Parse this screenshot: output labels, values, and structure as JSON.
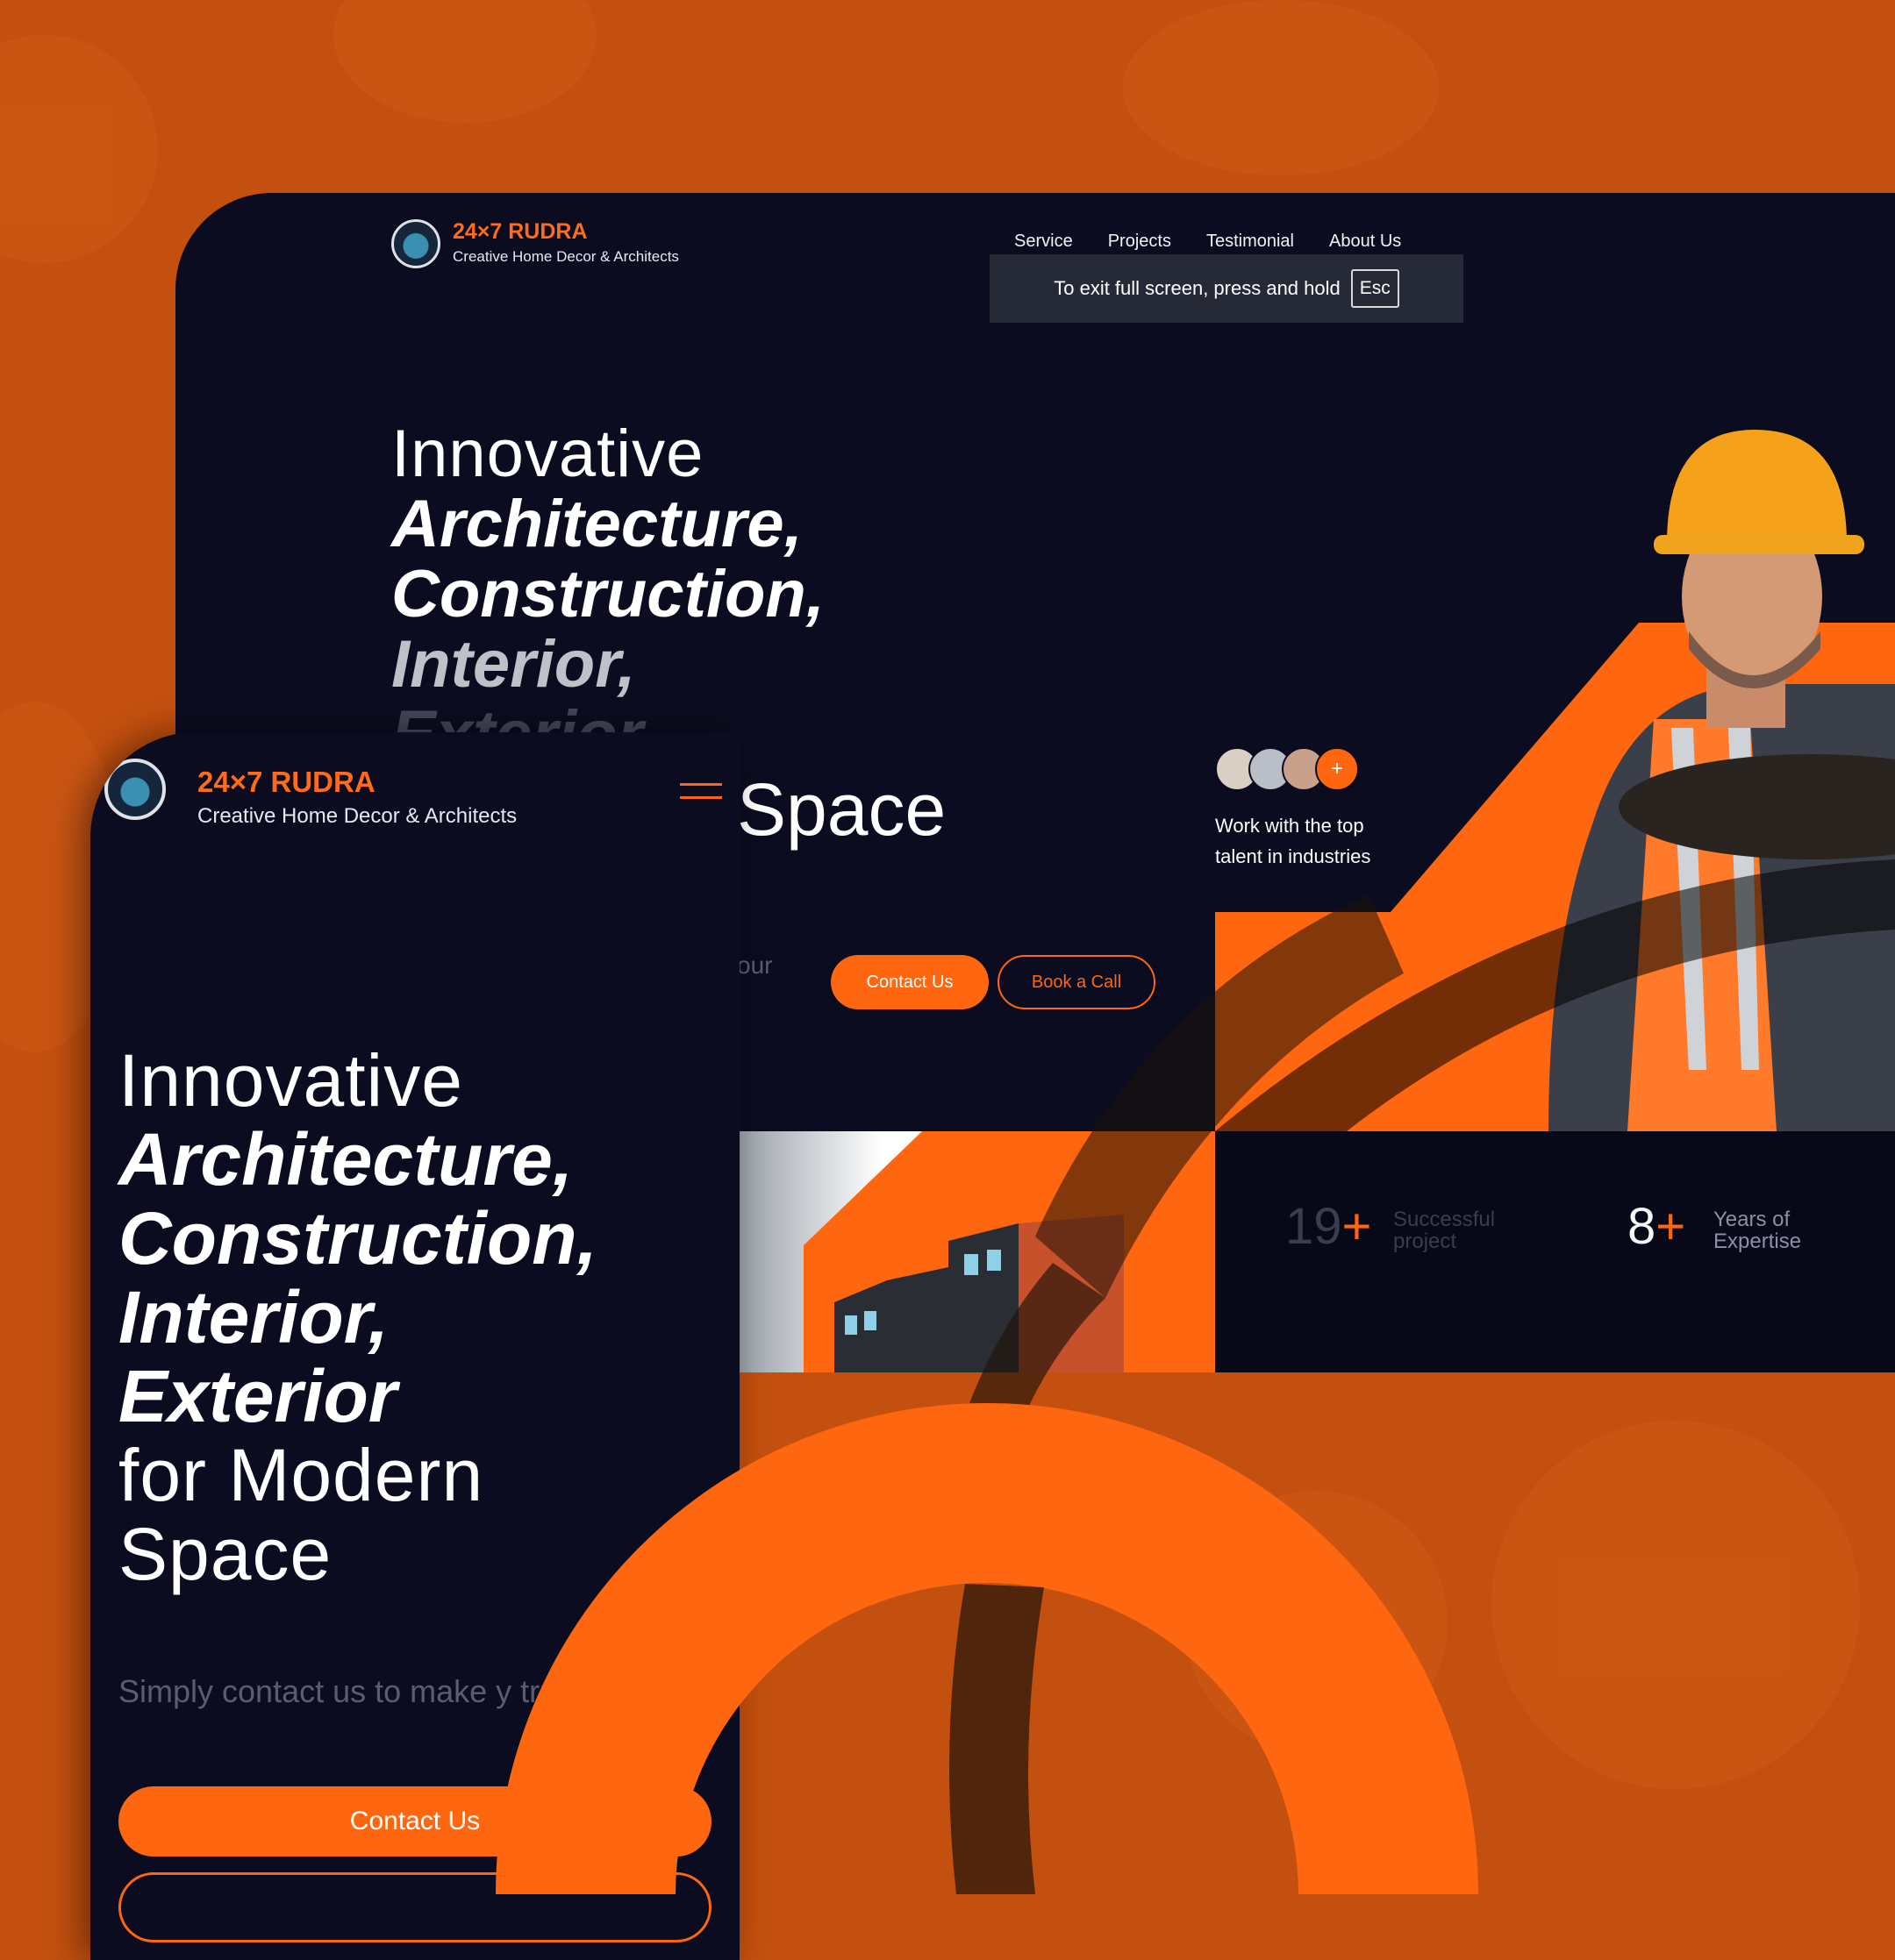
{
  "brand": {
    "name": "24×7 RUDRA",
    "tagline": "Creative Home Decor & Architects"
  },
  "nav": [
    "Service",
    "Projects",
    "Testimonial",
    "About Us"
  ],
  "fullscreen_notice": {
    "message": "To exit full screen, press and hold",
    "key": "Esc"
  },
  "desktop_hero": {
    "line1": "Innovative",
    "line2": "Architecture,",
    "line3": "Construction,",
    "line4": "Interior,",
    "line5": "Exterior",
    "space_fragment": "Space",
    "sub_fragment": "our"
  },
  "buttons": {
    "contact": "Contact Us",
    "book": "Book a Call"
  },
  "talent": {
    "plus": "+",
    "text": "Work with the top talent in industries"
  },
  "stats": [
    {
      "value": "19",
      "suffix": "+",
      "label1": "Successful",
      "label2": "project"
    },
    {
      "value": "8",
      "suffix": "+",
      "label1": "Years of",
      "label2": "Expertise"
    }
  ],
  "mobile_hero": {
    "line1": "Innovative",
    "line2": "Architecture,",
    "line3": "Construction,",
    "line4": "Interior,",
    "line5": "Exterior",
    "line6": "for Modern",
    "line7": "Space",
    "sub": "Simply contact us to make y true",
    "button": "Contact Us"
  },
  "colors": {
    "accent": "#ff6610",
    "panel": "#0b0c1f",
    "backdrop": "#c4500f"
  }
}
